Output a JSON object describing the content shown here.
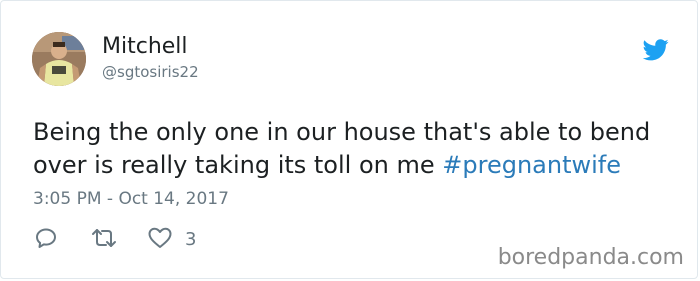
{
  "author": {
    "display_name": "Mitchell",
    "handle": "@sgtosiris22"
  },
  "tweet": {
    "text_line1": "Being the only one in our house that's able to bend",
    "text_line2_prefix": "over is really taking its toll on me ",
    "hashtag": "#pregnantwife",
    "timestamp": "3:05 PM - Oct 14, 2017"
  },
  "actions": {
    "reply_icon": "reply-icon",
    "retweet_icon": "retweet-icon",
    "like_icon": "heart-icon",
    "like_count": "3"
  },
  "watermark": "boredpanda.com",
  "colors": {
    "text": "#1c2022",
    "muted": "#697882",
    "link": "#2b7bb9",
    "twitter_blue": "#1da1f2",
    "border": "#e1e8ed"
  }
}
